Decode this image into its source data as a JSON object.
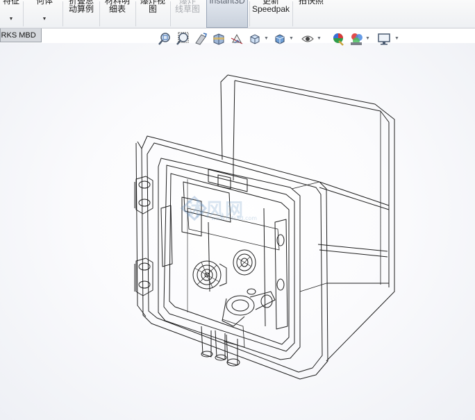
{
  "ribbon": {
    "commands": [
      {
        "line1": "特征",
        "line2": "",
        "has_dropdown": true,
        "state": "normal"
      },
      {
        "line1": "何体",
        "line2": "",
        "has_dropdown": true,
        "state": "normal"
      },
      {
        "line1": "折叠总",
        "line2": "动算例",
        "has_dropdown": false,
        "state": "normal"
      },
      {
        "line1": "材料明",
        "line2": "细表",
        "has_dropdown": false,
        "state": "normal"
      },
      {
        "line1": "爆炸视",
        "line2": "图",
        "has_dropdown": false,
        "state": "normal"
      },
      {
        "line1": "爆炸",
        "line2": "线草图",
        "has_dropdown": false,
        "state": "disabled"
      },
      {
        "line1": "Instant3D",
        "line2": "",
        "has_dropdown": false,
        "state": "active"
      },
      {
        "line1": "更新",
        "line2": "Speedpak",
        "has_dropdown": false,
        "state": "normal"
      },
      {
        "line1": "拍快照",
        "line2": "",
        "has_dropdown": false,
        "state": "normal"
      }
    ]
  },
  "tab": {
    "label": "ORKS MBD"
  },
  "view_toolbar": {
    "buttons": [
      {
        "icon": "zoom-to-fit-icon"
      },
      {
        "icon": "zoom-to-area-icon"
      },
      {
        "icon": "previous-view-icon"
      },
      {
        "icon": "section-view-icon"
      },
      {
        "icon": "dynamic-annotation-views-icon"
      },
      {
        "icon": "view-orientation-icon"
      },
      {
        "icon": "display-style-icon"
      },
      {
        "icon": "hide-show-items-icon"
      },
      {
        "icon": "edit-appearance-icon"
      },
      {
        "icon": "apply-scene-icon"
      },
      {
        "icon": "view-settings-icon"
      }
    ]
  },
  "watermark": {
    "text": "沐风网",
    "subtext": "www.mfcad.com"
  },
  "colors": {
    "ribbon_bg": "#eef0f3",
    "wire": "#1e1e1e",
    "viewport_edge": "#eef0f5"
  }
}
